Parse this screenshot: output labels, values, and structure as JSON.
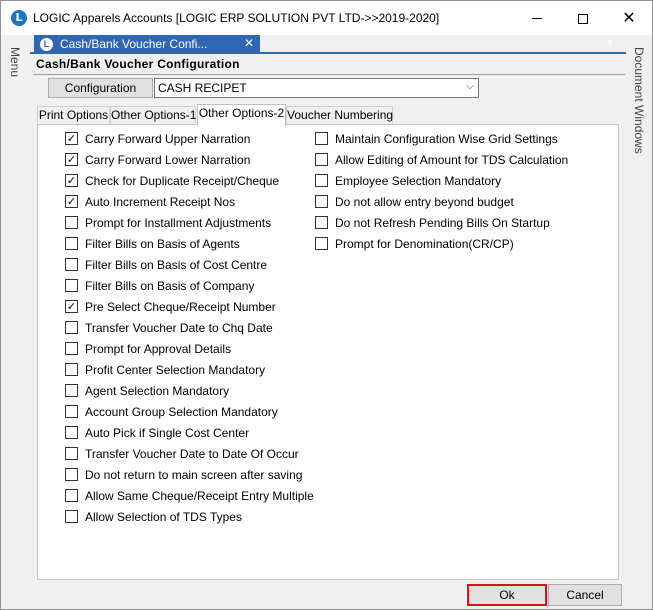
{
  "window": {
    "title": "LOGIC Apparels Accounts  [LOGIC ERP SOLUTION PVT LTD->>2019-2020]",
    "app_icon_letter": "L",
    "minimize_icon": "minimize-icon",
    "maximize_icon": "maximize-icon",
    "close_glyph": "✕"
  },
  "side": {
    "left_label": "Menu",
    "right_label": "Document Windows"
  },
  "doc_tab": {
    "icon_letter": "L",
    "label": "Cash/Bank Voucher Confi...",
    "close_glyph": "✕",
    "overflow_glyph": "▼"
  },
  "form": {
    "header": "Cash/Bank Voucher Configuration",
    "configuration_label": "Configuration",
    "configuration_value": "CASH RECIPET",
    "dropdown_glyph": "⌵"
  },
  "tabs": [
    {
      "label": "Print Options",
      "active": false
    },
    {
      "label": "Other Options-1",
      "active": false
    },
    {
      "label": "Other Options-2",
      "active": true
    },
    {
      "label": "Voucher Numbering",
      "active": false
    }
  ],
  "options_left": [
    {
      "label": "Carry Forward Upper Narration",
      "checked": true
    },
    {
      "label": "Carry Forward Lower Narration",
      "checked": true
    },
    {
      "label": "Check for Duplicate Receipt/Cheque",
      "checked": true
    },
    {
      "label": "Auto Increment Receipt Nos",
      "checked": true
    },
    {
      "label": "Prompt for Installment Adjustments",
      "checked": false
    },
    {
      "label": "Filter Bills on Basis of Agents",
      "checked": false
    },
    {
      "label": "Filter Bills on Basis of Cost Centre",
      "checked": false
    },
    {
      "label": "Filter Bills on Basis of Company",
      "checked": false
    },
    {
      "label": "Pre Select Cheque/Receipt Number",
      "checked": true
    },
    {
      "label": "Transfer Voucher Date to Chq Date",
      "checked": false
    },
    {
      "label": "Prompt for Approval Details",
      "checked": false
    },
    {
      "label": "Profit Center Selection Mandatory",
      "checked": false
    },
    {
      "label": "Agent Selection Mandatory",
      "checked": false
    },
    {
      "label": "Account Group Selection Mandatory",
      "checked": false
    },
    {
      "label": "Auto Pick if Single Cost Center",
      "checked": false
    },
    {
      "label": "Transfer  Voucher Date to Date Of Occur",
      "checked": false
    },
    {
      "label": "Do not return to main screen after saving",
      "checked": false
    },
    {
      "label": "Allow Same Cheque/Receipt Entry Multiple",
      "checked": false
    },
    {
      "label": "Allow Selection of TDS Types",
      "checked": false
    }
  ],
  "options_right": [
    {
      "label": "Maintain Configuration Wise Grid Settings",
      "checked": false
    },
    {
      "label": "Allow Editing of Amount for TDS Calculation",
      "checked": false
    },
    {
      "label": "Employee Selection Mandatory",
      "checked": false
    },
    {
      "label": "Do not allow entry beyond budget",
      "checked": false
    },
    {
      "label": "Do not Refresh Pending Bills On Startup",
      "checked": false
    },
    {
      "label": "Prompt for Denomination(CR/CP)",
      "checked": false
    }
  ],
  "buttons": {
    "ok": "Ok",
    "cancel": "Cancel"
  },
  "check_glyph": "✓"
}
